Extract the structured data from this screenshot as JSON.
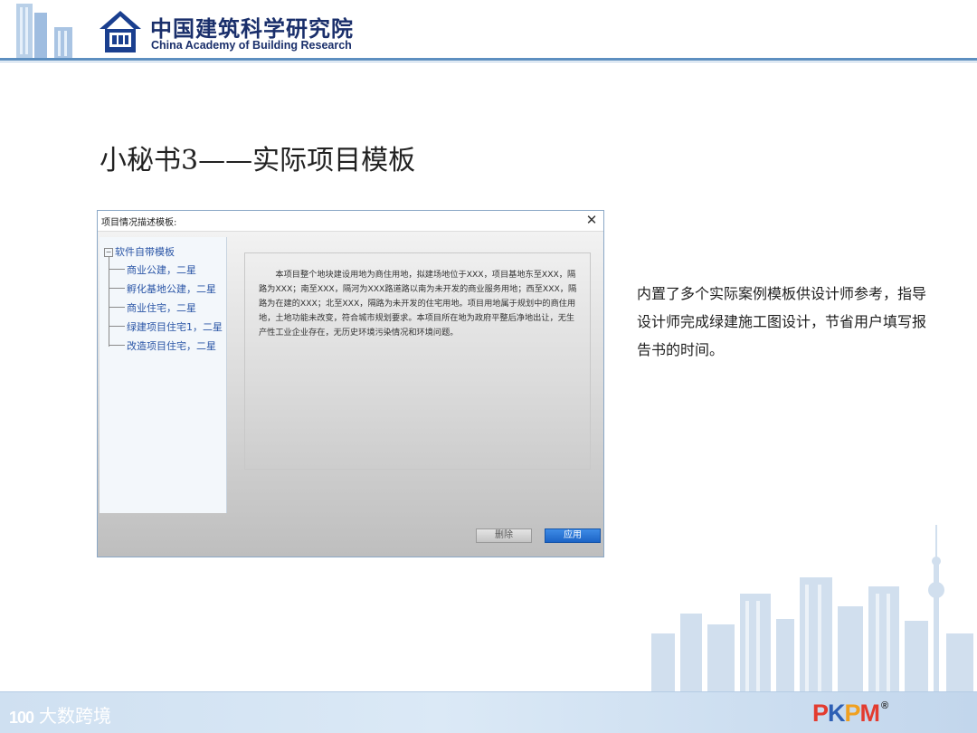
{
  "header": {
    "org_name_cn": "中国建筑科学研究院",
    "org_name_en": "China Academy of Building Research"
  },
  "slide": {
    "title": "小秘书3——实际项目模板"
  },
  "dialog": {
    "title": "项目情况描述模板:",
    "close_icon": "close-icon",
    "tree": {
      "root_label": "软件自带模板",
      "items": [
        {
          "label": "商业公建，二星"
        },
        {
          "label": "孵化基地公建，二星"
        },
        {
          "label": "商业住宅，二星"
        },
        {
          "label": "绿建项目住宅1，二星"
        },
        {
          "label": "改造项目住宅，二星"
        }
      ]
    },
    "description": "本项目整个地块建设用地为商住用地，拟建场地位于XXX，项目基地东至XXX，隔路为XXX；南至XXX，隔河为XXX路道路以南为未开发的商业服务用地；西至XXX，隔路为在建的XXX；北至XXX，隔路为未开发的住宅用地。项目用地属于规划中的商住用地，土地功能未改变，符合城市规划要求。本项目所在地为政府平整后净地出让，无生产性工业企业存在，无历史环境污染情况和环境问题。",
    "buttons": {
      "delete_label": "删除",
      "apply_label": "应用"
    }
  },
  "right_text": "内置了多个实际案例模板供设计师参考，指导设计师完成绿建施工图设计，节省用户填写报告书的时间。",
  "footer": {
    "watermark_mark": "100",
    "watermark_text": "大数跨境",
    "brand": {
      "p1": "P",
      "k": "K",
      "p2": "P",
      "m": "M",
      "reg": "®"
    }
  },
  "colors": {
    "header_rule": "#5d8fc0",
    "org_text": "#1a2f6b",
    "tree_text": "#2a55a6",
    "apply_button": "#1c64c6"
  }
}
